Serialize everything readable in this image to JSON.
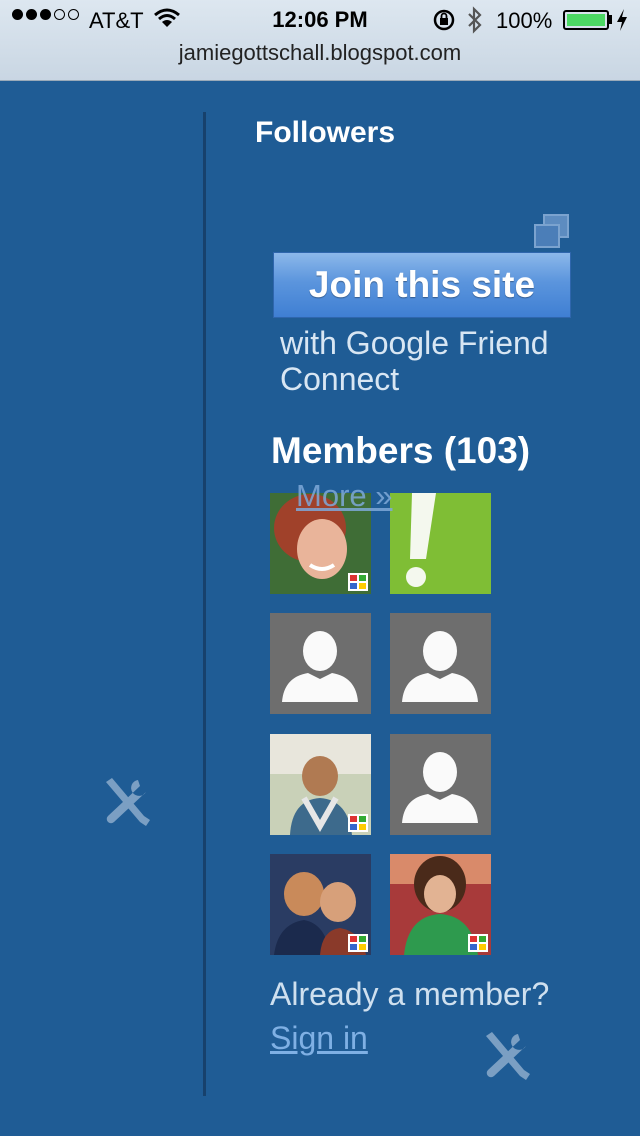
{
  "status_bar": {
    "carrier": "AT&T",
    "time": "12:06 PM",
    "battery_percent": "100%"
  },
  "url_bar": {
    "url": "jamiegottschall.blogspot.com"
  },
  "widget": {
    "title": "Followers",
    "join_button_label": "Join this site",
    "with_google_text": "with Google Friend Connect",
    "members_title": "Members (103)",
    "more_link": "More »",
    "already_member_text": "Already a member?",
    "sign_in_link": "Sign in"
  },
  "members": [
    {
      "kind": "photo",
      "icon": "woman-redhair-photo"
    },
    {
      "kind": "exclamation",
      "icon": "green-exclamation-avatar"
    },
    {
      "kind": "default",
      "icon": "default-user-avatar"
    },
    {
      "kind": "default",
      "icon": "default-user-avatar"
    },
    {
      "kind": "photo",
      "icon": "woman-outdoor-photo"
    },
    {
      "kind": "default",
      "icon": "default-user-avatar"
    },
    {
      "kind": "photo",
      "icon": "couple-photo"
    },
    {
      "kind": "photo",
      "icon": "woman-green-photo"
    }
  ],
  "colors": {
    "page_background": "#1f5c95",
    "join_button": "#4a8ad8",
    "link": "#7fb0e4"
  }
}
